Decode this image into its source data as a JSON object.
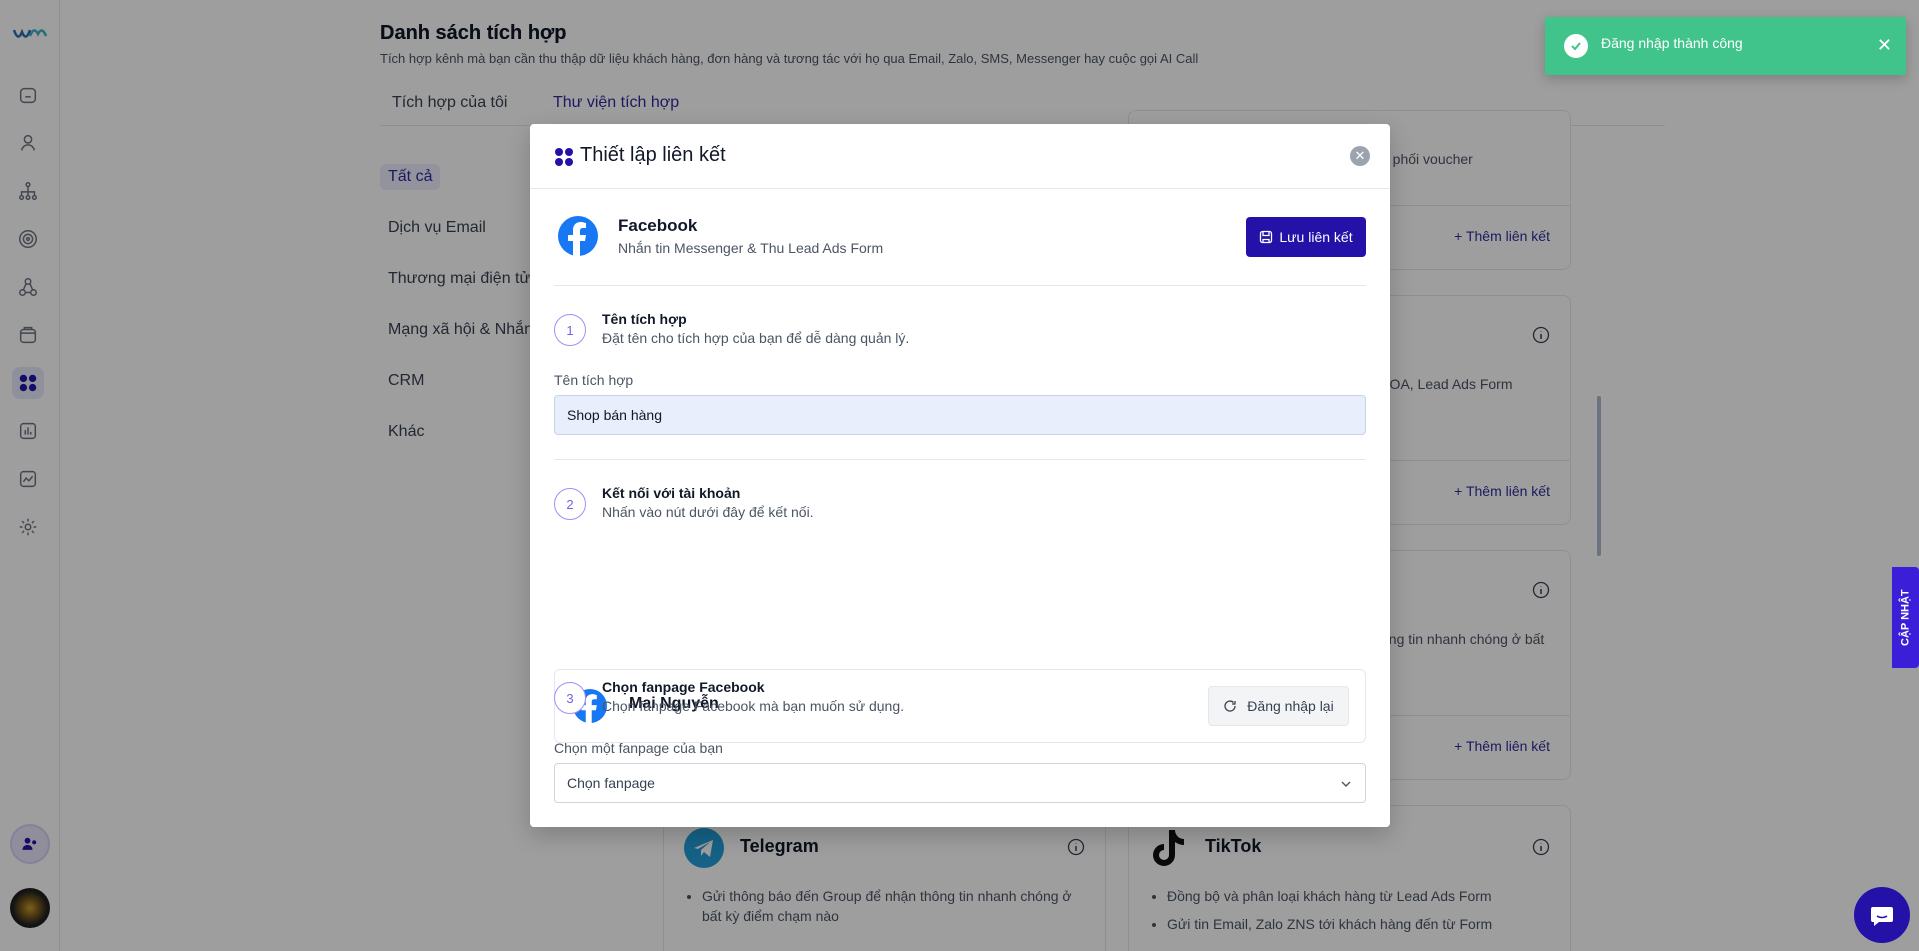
{
  "page": {
    "title": "Danh sách tích hợp",
    "subtitle": "Tích hợp kênh mà bạn cần thu thập dữ liệu khách hàng, đơn hàng và tương tác với họ qua Email, Zalo, SMS, Messenger hay cuộc gọi AI Call",
    "tabs": [
      "Tích hợp của tôi",
      "Thư viện tích hợp"
    ],
    "active_tab": "Thư viện tích hợp",
    "categories": [
      "Tất cả",
      "Dịch vụ Email",
      "Thương mại điện tử",
      "Mạng xã hội & Nhắn",
      "CRM",
      "Khác"
    ]
  },
  "cards": {
    "add_link_label": "Thêm liên kết",
    "snippet_voucher": "n phối voucher",
    "snippet_zalo": "r OA, Lead Ads Form",
    "snippet_info": "ông tin nhanh chóng ở bất",
    "telegram": {
      "title": "Telegram",
      "bullets": [
        "Gửi thông báo đến Group để nhận thông tin nhanh chóng ở bất kỳ điểm chạm nào"
      ]
    },
    "tiktok": {
      "title": "TikTok",
      "bullets": [
        "Đồng bộ và phân loại khách hàng từ Lead Ads Form",
        "Gửi tin Email, Zalo ZNS tới khách hàng đến từ Form"
      ]
    }
  },
  "modal": {
    "title": "Thiết lập liên kết",
    "provider_name": "Facebook",
    "provider_desc": "Nhắn tin Messenger & Thu Lead Ads Form",
    "save_label": "Lưu liên kết",
    "step1": {
      "number": "1",
      "title": "Tên tích hợp",
      "desc": "Đặt tên cho tích hợp của bạn để dễ dàng quản lý.",
      "field_label": "Tên tích hợp",
      "value": "Shop bán hàng"
    },
    "step2": {
      "number": "2",
      "title": "Kết nối với tài khoản",
      "desc": "Nhấn vào nút dưới đây để kết nối.",
      "account_name": "Mai Nguyễn",
      "relogin_label": "Đăng nhập lại"
    },
    "step3": {
      "number": "3",
      "title": "Chọn fanpage Facebook",
      "desc": "Chọn fanpage Facebook mà bạn muốn sử dụng.",
      "field_label": "Chọn một fanpage của bạn",
      "select_value": "Chọn fanpage"
    }
  },
  "toast": {
    "message": "Đăng nhập thành công"
  },
  "update_tab": "CẬP NHẬT",
  "colors": {
    "primary": "#2412a8",
    "toast": "#41c38c",
    "facebook": "#1877f2"
  }
}
